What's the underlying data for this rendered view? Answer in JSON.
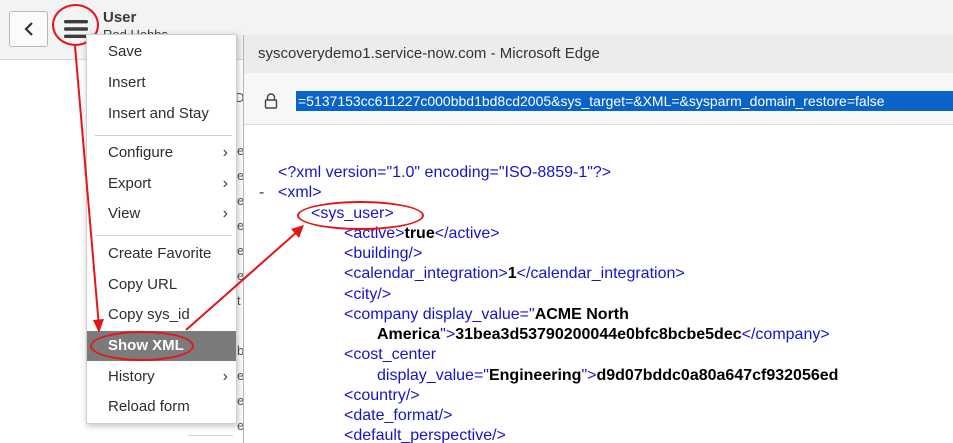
{
  "header": {
    "title": "User",
    "subtitle": "Rod Hobbs"
  },
  "background_fragments": [
    "D",
    "e",
    "e",
    "e",
    "e",
    "e",
    "e",
    "t",
    "b",
    "e",
    "e",
    "e"
  ],
  "menu": {
    "items": [
      {
        "label": "Save",
        "submenu": false
      },
      {
        "label": "Insert",
        "submenu": false
      },
      {
        "label": "Insert and Stay",
        "submenu": false
      },
      {
        "label": "Configure",
        "submenu": true
      },
      {
        "label": "Export",
        "submenu": true
      },
      {
        "label": "View",
        "submenu": true
      },
      {
        "label": "Create Favorite",
        "submenu": false
      },
      {
        "label": "Copy URL",
        "submenu": false
      },
      {
        "label": "Copy sys_id",
        "submenu": false
      },
      {
        "label": "Show XML",
        "submenu": false,
        "selected": true
      },
      {
        "label": "History",
        "submenu": true
      },
      {
        "label": "Reload form",
        "submenu": false
      }
    ],
    "chevron": "›"
  },
  "browser": {
    "window_title": "syscoverydemo1.service-now.com - Microsoft Edge",
    "url": "=5137153cc611227c000bbd1bd8cd2005&sys_target=&XML=&sysparm_domain_restore=false"
  },
  "xml": {
    "declaration": "<?xml version=\"1.0\" encoding=\"ISO-8859-1\"?>",
    "root_open": "<xml>",
    "sys_user_open": "<sys_user>",
    "minus": "-",
    "lines": {
      "active": {
        "open": "<active>",
        "value": "true",
        "close": "</active>"
      },
      "building": "<building/>",
      "calendar_integration": {
        "open": "<calendar_integration>",
        "value": "1",
        "close": "</calendar_integration>"
      },
      "city": "<city/>",
      "company_open": "<company display_value=\"",
      "company_dv1": "ACME North",
      "company_dv2": "America",
      "company_mid": "\">",
      "company_value": "31bea3d53790200044e0bfc8bcbe5dec",
      "company_close": "</company>",
      "cost_center_open": "<cost_center",
      "cost_center_attr": "display_value=\"",
      "cost_center_dv": "Engineering",
      "cost_center_mid": "\">",
      "cost_center_value": "d9d07bddc0a80a647cf932056ed",
      "country": "<country/>",
      "date_format": "<date_format/>",
      "default_perspective": "<default_perspective/>"
    }
  },
  "colors": {
    "annotation": "#e3161a",
    "menu_selected": "#7b7b7b",
    "url_highlight": "#0a64c8",
    "xml_tag_blue": "#1515c8",
    "xml_attr_dark_red": "#990000"
  },
  "icons": [
    "back-arrow-icon",
    "hamburger-menu-icon",
    "lock-icon",
    "chevron-right-icon"
  ]
}
